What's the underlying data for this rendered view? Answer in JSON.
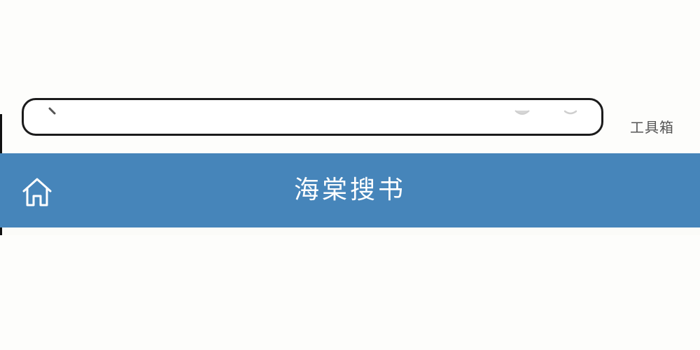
{
  "toolbar": {
    "toolbox_label": "工具箱"
  },
  "header": {
    "title": "海棠搜书",
    "background_color": "#4685ba"
  },
  "icons": {
    "home": "home-icon",
    "search": "search-icon",
    "clear": "clear-icon",
    "voice": "voice-icon"
  }
}
